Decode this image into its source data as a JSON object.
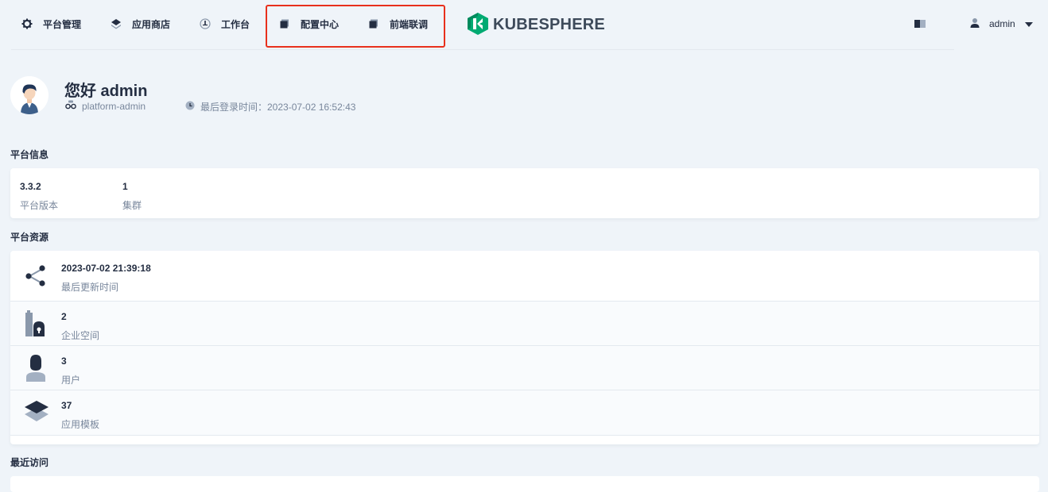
{
  "nav": {
    "items": [
      {
        "label": "平台管理",
        "icon": "gear-icon"
      },
      {
        "label": "应用商店",
        "icon": "layers-icon"
      },
      {
        "label": "工作台",
        "icon": "compass-icon"
      },
      {
        "label": "配置中心",
        "icon": "cube-icon"
      },
      {
        "label": "前端联调",
        "icon": "cube-icon"
      }
    ],
    "logo_text": "KUBESPHERE",
    "user": "admin"
  },
  "header": {
    "greeting": "您好 admin",
    "role": "platform-admin",
    "last_login": "最后登录时间：2023-07-02 16:52:43"
  },
  "platform_info": {
    "title": "平台信息",
    "items": [
      {
        "value": "3.3.2",
        "label": "平台版本"
      },
      {
        "value": "1",
        "label": "集群"
      }
    ]
  },
  "platform_resources": {
    "title": "平台资源",
    "items": [
      {
        "value": "2023-07-02 21:39:18",
        "label": "最后更新时间",
        "icon": "share-nodes-icon"
      },
      {
        "value": "2",
        "label": "企业空间",
        "icon": "enterprise-icon"
      },
      {
        "value": "3",
        "label": "用户",
        "icon": "user-icon"
      },
      {
        "value": "37",
        "label": "应用模板",
        "icon": "app-template-icon"
      }
    ]
  },
  "recent": {
    "title": "最近访问"
  },
  "colors": {
    "highlight": "#e8301c",
    "logo_green": "#00aa72",
    "text": "#242e42",
    "muted": "#79879c",
    "background": "#eff4f9"
  }
}
